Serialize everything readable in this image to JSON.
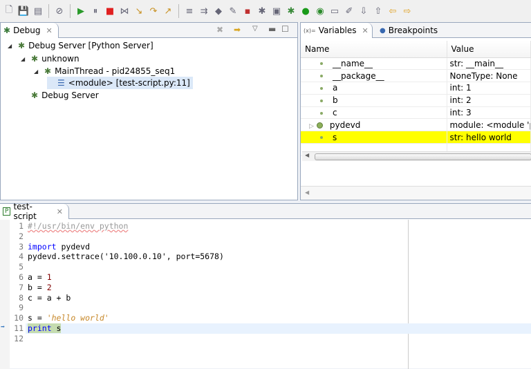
{
  "toolbar": {
    "icons": [
      "new-icon",
      "save-icon",
      "save-all-icon",
      "skip-breakpoints-icon",
      "resume-icon",
      "suspend-icon",
      "terminate-icon",
      "disconnect-icon",
      "step-into-icon",
      "step-over-icon",
      "step-return-icon",
      "drop-to-frame-icon",
      "use-step-filters-icon",
      "python-icon",
      "pydev-icon",
      "breakpoint-icon",
      "debug-server-icon",
      "open-type-icon",
      "debug-icon",
      "run-icon",
      "coverage-icon",
      "open-file-icon",
      "search-icon",
      "next-annotation-icon",
      "prev-annotation-icon",
      "back-icon",
      "forward-icon"
    ]
  },
  "debug": {
    "tab_label": "Debug",
    "tree": [
      {
        "label": "Debug Server [Python Server]",
        "level": 0,
        "expanded": true
      },
      {
        "label": "unknown",
        "level": 1,
        "expanded": true
      },
      {
        "label": "MainThread - pid24855_seq1",
        "level": 2,
        "expanded": true
      },
      {
        "label": "<module> [test-script.py:11]",
        "level": 3,
        "selected": true
      },
      {
        "label": "Debug Server",
        "level": 1
      }
    ]
  },
  "variables": {
    "tab_label": "Variables",
    "tab_prefix": "(x)=",
    "breakpoints_label": "Breakpoints",
    "columns": [
      "Name",
      "Value"
    ],
    "rows": [
      {
        "name": "__name__",
        "value": "str: __main__"
      },
      {
        "name": "__package__",
        "value": "NoneType: None"
      },
      {
        "name": "a",
        "value": "int: 1"
      },
      {
        "name": "b",
        "value": "int: 2"
      },
      {
        "name": "c",
        "value": "int: 3"
      },
      {
        "name": "pydevd",
        "value": "module: <module 'pydevd'",
        "expandable": true
      },
      {
        "name": "s",
        "value": "str: hello world",
        "highlighted": true
      }
    ]
  },
  "editor": {
    "tab_label": "test-script",
    "current_line": 11,
    "lines": [
      "#!/usr/bin/env python",
      "",
      "import pydevd",
      "pydevd.settrace('10.100.0.10', port=5678)",
      "",
      "a = 1",
      "b = 2",
      "c = a + b",
      "",
      "s = 'hello world'",
      "print s"
    ]
  },
  "colors": {
    "highlight": "#ffff00",
    "current_line": "#e8f2fe",
    "keyword": "#0000ff",
    "string": "#c7882a"
  }
}
